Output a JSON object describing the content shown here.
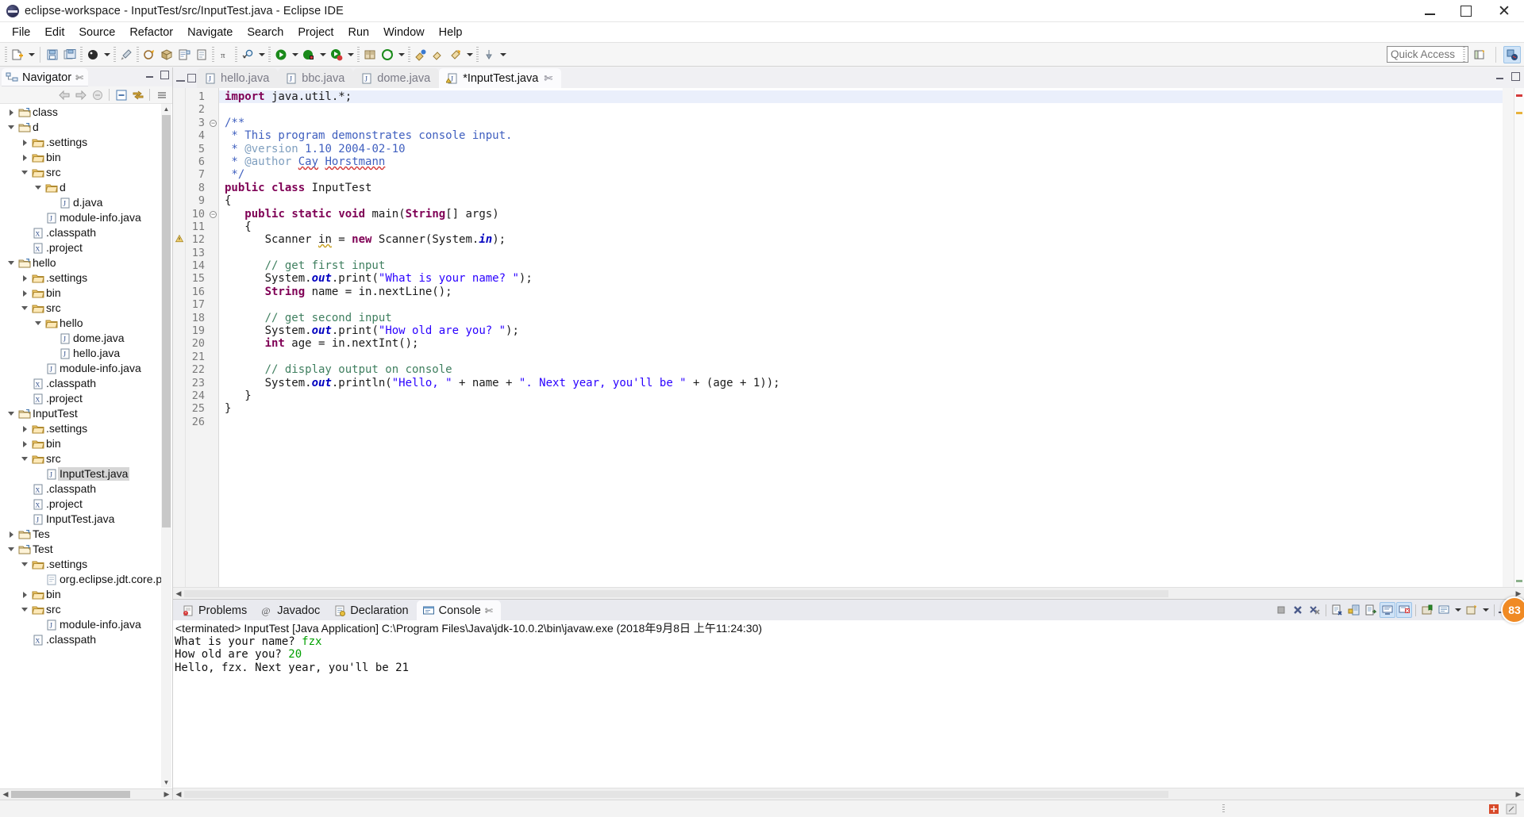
{
  "window": {
    "title": "eclipse-workspace - InputTest/src/InputTest.java - Eclipse IDE",
    "logo_icon": "eclipse-logo-icon",
    "minimize_icon": "minimize-icon",
    "maximize_icon": "maximize-icon",
    "close_icon": "close-icon"
  },
  "menubar": {
    "items": [
      {
        "label": "File"
      },
      {
        "label": "Edit"
      },
      {
        "label": "Source"
      },
      {
        "label": "Refactor"
      },
      {
        "label": "Navigate"
      },
      {
        "label": "Search"
      },
      {
        "label": "Project"
      },
      {
        "label": "Run"
      },
      {
        "label": "Window"
      },
      {
        "label": "Help"
      }
    ]
  },
  "toolbar": {
    "quick_access_placeholder": "Quick Access",
    "quick_access_value": "",
    "open_perspective_icon": "open-perspective-icon",
    "java_perspective_icon": "java-perspective-icon"
  },
  "navigator": {
    "tab_label": "Navigator",
    "close_icon": "close-icon",
    "minimize_icon": "minimize-icon",
    "maximize_icon": "maximize-icon",
    "toolbar_icons": [
      "back-icon",
      "forward-icon",
      "home-icon",
      "collapse-all-icon",
      "link-with-editor-icon",
      "view-menu-icon"
    ],
    "tree": [
      {
        "label": "class",
        "depth": 0,
        "twisty": "closed",
        "icon": "project-folder-icon"
      },
      {
        "label": "d",
        "depth": 0,
        "twisty": "open",
        "icon": "project-folder-icon"
      },
      {
        "label": ".settings",
        "depth": 1,
        "twisty": "closed",
        "icon": "folder-icon"
      },
      {
        "label": "bin",
        "depth": 1,
        "twisty": "closed",
        "icon": "folder-icon"
      },
      {
        "label": "src",
        "depth": 1,
        "twisty": "open",
        "icon": "folder-icon"
      },
      {
        "label": "d",
        "depth": 2,
        "twisty": "open",
        "icon": "folder-icon"
      },
      {
        "label": "d.java",
        "depth": 3,
        "twisty": "none",
        "icon": "java-file-icon"
      },
      {
        "label": "module-info.java",
        "depth": 2,
        "twisty": "none",
        "icon": "java-file-icon"
      },
      {
        "label": ".classpath",
        "depth": 1,
        "twisty": "none",
        "icon": "xml-file-icon"
      },
      {
        "label": ".project",
        "depth": 1,
        "twisty": "none",
        "icon": "xml-file-icon"
      },
      {
        "label": "hello",
        "depth": 0,
        "twisty": "open",
        "icon": "project-folder-icon"
      },
      {
        "label": ".settings",
        "depth": 1,
        "twisty": "closed",
        "icon": "folder-icon"
      },
      {
        "label": "bin",
        "depth": 1,
        "twisty": "closed",
        "icon": "folder-icon"
      },
      {
        "label": "src",
        "depth": 1,
        "twisty": "open",
        "icon": "folder-icon"
      },
      {
        "label": "hello",
        "depth": 2,
        "twisty": "open",
        "icon": "folder-icon"
      },
      {
        "label": "dome.java",
        "depth": 3,
        "twisty": "none",
        "icon": "java-file-icon"
      },
      {
        "label": "hello.java",
        "depth": 3,
        "twisty": "none",
        "icon": "java-file-icon"
      },
      {
        "label": "module-info.java",
        "depth": 2,
        "twisty": "none",
        "icon": "java-file-icon"
      },
      {
        "label": ".classpath",
        "depth": 1,
        "twisty": "none",
        "icon": "xml-file-icon"
      },
      {
        "label": ".project",
        "depth": 1,
        "twisty": "none",
        "icon": "xml-file-icon"
      },
      {
        "label": "InputTest",
        "depth": 0,
        "twisty": "open",
        "icon": "project-folder-icon"
      },
      {
        "label": ".settings",
        "depth": 1,
        "twisty": "closed",
        "icon": "folder-icon"
      },
      {
        "label": "bin",
        "depth": 1,
        "twisty": "closed",
        "icon": "folder-icon"
      },
      {
        "label": "src",
        "depth": 1,
        "twisty": "open",
        "icon": "folder-icon"
      },
      {
        "label": "InputTest.java",
        "depth": 2,
        "twisty": "none",
        "icon": "java-file-icon",
        "selected": true
      },
      {
        "label": ".classpath",
        "depth": 1,
        "twisty": "none",
        "icon": "xml-file-icon"
      },
      {
        "label": ".project",
        "depth": 1,
        "twisty": "none",
        "icon": "xml-file-icon"
      },
      {
        "label": "InputTest.java",
        "depth": 1,
        "twisty": "none",
        "icon": "java-file-icon"
      },
      {
        "label": "Tes",
        "depth": 0,
        "twisty": "closed",
        "icon": "project-folder-icon"
      },
      {
        "label": "Test",
        "depth": 0,
        "twisty": "open",
        "icon": "project-folder-icon"
      },
      {
        "label": ".settings",
        "depth": 1,
        "twisty": "open",
        "icon": "folder-icon"
      },
      {
        "label": "org.eclipse.jdt.core.p",
        "depth": 2,
        "twisty": "none",
        "icon": "text-file-icon"
      },
      {
        "label": "bin",
        "depth": 1,
        "twisty": "closed",
        "icon": "folder-icon"
      },
      {
        "label": "src",
        "depth": 1,
        "twisty": "open",
        "icon": "folder-icon"
      },
      {
        "label": "module-info.java",
        "depth": 2,
        "twisty": "none",
        "icon": "java-file-icon"
      },
      {
        "label": ".classpath",
        "depth": 1,
        "twisty": "none",
        "icon": "xml-file-icon"
      }
    ]
  },
  "editor": {
    "tabs": [
      {
        "label": "hello.java",
        "active": false,
        "dirty": false,
        "icon": "java-file-icon"
      },
      {
        "label": "bbc.java",
        "active": false,
        "dirty": false,
        "icon": "java-file-icon"
      },
      {
        "label": "dome.java",
        "active": false,
        "dirty": false,
        "icon": "java-file-icon"
      },
      {
        "label": "*InputTest.java",
        "active": true,
        "dirty": true,
        "icon": "java-file-warning-icon",
        "close_icon": "close-icon"
      }
    ],
    "minimize_icon": "minimize-icon",
    "maximize_icon": "maximize-icon",
    "restore_icon": "restore-icon",
    "line_numbers": [
      1,
      2,
      3,
      4,
      5,
      6,
      7,
      8,
      9,
      10,
      11,
      12,
      13,
      14,
      15,
      16,
      17,
      18,
      19,
      20,
      21,
      22,
      23,
      24,
      25,
      26
    ],
    "lines": [
      {
        "n": 1,
        "text": "import java.util.*;"
      },
      {
        "n": 2,
        "text": ""
      },
      {
        "n": 3,
        "text": "/**",
        "fold": true
      },
      {
        "n": 4,
        "text": " * This program demonstrates console input."
      },
      {
        "n": 5,
        "text": " * @version 1.10 2004-02-10"
      },
      {
        "n": 6,
        "text": " * @author Cay Horstmann"
      },
      {
        "n": 7,
        "text": " */"
      },
      {
        "n": 8,
        "text": "public class InputTest"
      },
      {
        "n": 9,
        "text": "{"
      },
      {
        "n": 10,
        "text": "   public static void main(String[] args)",
        "fold": true
      },
      {
        "n": 11,
        "text": "   {"
      },
      {
        "n": 12,
        "text": "      Scanner in = new Scanner(System.in);",
        "marker": "warning"
      },
      {
        "n": 13,
        "text": ""
      },
      {
        "n": 14,
        "text": "      // get first input"
      },
      {
        "n": 15,
        "text": "      System.out.print(\"What is your name? \");"
      },
      {
        "n": 16,
        "text": "      String name = in.nextLine();"
      },
      {
        "n": 17,
        "text": ""
      },
      {
        "n": 18,
        "text": "      // get second input"
      },
      {
        "n": 19,
        "text": "      System.out.print(\"How old are you? \");"
      },
      {
        "n": 20,
        "text": "      int age = in.nextInt();"
      },
      {
        "n": 21,
        "text": ""
      },
      {
        "n": 22,
        "text": "      // display output on console"
      },
      {
        "n": 23,
        "text": "      System.out.println(\"Hello, \" + name + \". Next year, you'll be \" + (age + 1));"
      },
      {
        "n": 24,
        "text": "   }"
      },
      {
        "n": 25,
        "text": "}"
      },
      {
        "n": 26,
        "text": ""
      }
    ]
  },
  "console": {
    "tabs": [
      {
        "label": "Problems",
        "icon": "problems-icon",
        "active": false
      },
      {
        "label": "Javadoc",
        "icon": "javadoc-icon",
        "active": false
      },
      {
        "label": "Declaration",
        "icon": "declaration-icon",
        "active": false
      },
      {
        "label": "Console",
        "icon": "console-icon",
        "active": true,
        "close_icon": "close-icon"
      }
    ],
    "header": "<terminated> InputTest [Java Application] C:\\Program Files\\Java\\jdk-10.0.2\\bin\\javaw.exe (2018年9月8日 上午11:24:30)",
    "output": [
      {
        "prompt": "What is your name? ",
        "input": "fzx"
      },
      {
        "prompt": "How old are you? ",
        "input": "20"
      },
      {
        "prompt": "Hello, fzx. Next year, you'll be 21",
        "input": ""
      }
    ],
    "toolbar_icons": [
      "terminate-all-icon",
      "remove-launch-icon",
      "remove-all-terminated-icon",
      "clear-console-icon",
      "scroll-lock-icon",
      "word-wrap-icon",
      "show-console-on-output-icon",
      "show-console-on-error-icon",
      "pin-console-icon",
      "display-selected-console-icon",
      "open-console-icon",
      "minimize-icon",
      "maximize-icon"
    ],
    "badge": "83",
    "minimize_icon": "minimize-icon",
    "maximize_icon": "maximize-icon"
  },
  "statusbar": {
    "right_icons": [
      "writable-indicator-icon",
      "smart-insert-icon"
    ]
  }
}
